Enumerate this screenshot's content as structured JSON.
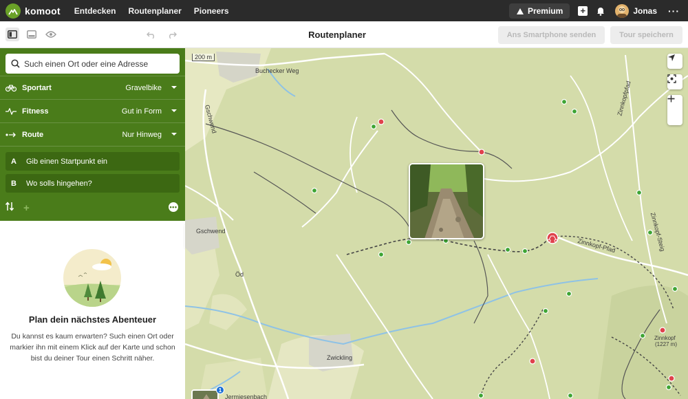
{
  "topbar": {
    "brand": "komoot",
    "nav": [
      "Entdecken",
      "Routenplaner",
      "Pioneers"
    ],
    "premium_label": "Premium",
    "username": "Jonas",
    "more": "···"
  },
  "subbar": {
    "title": "Routenplaner",
    "send_button": "Ans Smartphone senden",
    "save_button": "Tour speichern"
  },
  "sidebar": {
    "search_placeholder": "Such einen Ort oder eine Adresse",
    "sport": {
      "label": "Sportart",
      "value": "Gravelbike"
    },
    "fitness": {
      "label": "Fitness",
      "value": "Gut in Form"
    },
    "route": {
      "label": "Route",
      "value": "Nur Hinweg"
    },
    "waypoint_a": {
      "letter": "A",
      "text": "Gib einen Startpunkt ein"
    },
    "waypoint_b": {
      "letter": "B",
      "text": "Wo solls hingehen?"
    },
    "plan_title": "Plan dein nächstes Abenteuer",
    "plan_desc": "Du kannst es kaum erwarten? Such einen Ort oder markier ihn mit einem Klick auf der Karte und schon bist du deiner Tour einen Schritt näher."
  },
  "map": {
    "scale": "200 m",
    "labels": {
      "buchecker": "Buchecker Weg",
      "gschwend_road": "Gschwend",
      "gschwend": "Gschwend",
      "od": "Öd",
      "zwickling": "Zwickling",
      "zinnkopf_pfad": "Zinnkopf-Pfad",
      "zinnkopf_steig": "Zinnkopf-Steig",
      "zinnkopfpfad_top": "Zinnkopfpfad",
      "zinnkopf": "Zinnkopf",
      "zinnkopf_elev": "(1227 m)",
      "jermiesenbach": "Jermiesenbach"
    },
    "photo_badge": "1"
  },
  "colors": {
    "topbar": "#2b2b2b",
    "sidebar_green": "#4a7c1a",
    "map_base": "#d4dcaa",
    "trail_point": "#3fa534",
    "poi_red": "#e0424c"
  }
}
